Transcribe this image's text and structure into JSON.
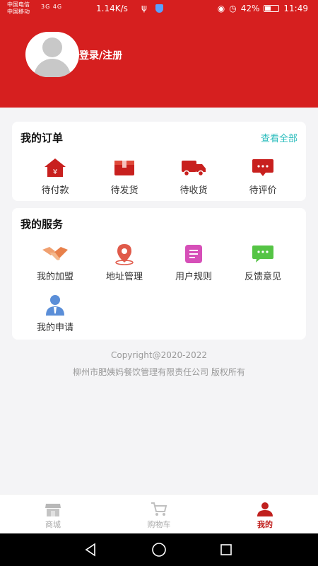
{
  "status_bar": {
    "carrier_1": "中国电信",
    "carrier_2": "中国移动",
    "signal": "3G 4G",
    "speed": "1.14K/s",
    "battery": "42%",
    "time": "11:49"
  },
  "header": {
    "login_label": "登录/注册"
  },
  "orders": {
    "title": "我的订单",
    "view_all": "查看全部",
    "items": [
      {
        "label": "待付款",
        "icon": "house-yen-icon"
      },
      {
        "label": "待发货",
        "icon": "package-icon"
      },
      {
        "label": "待收货",
        "icon": "truck-icon"
      },
      {
        "label": "待评价",
        "icon": "comment-icon"
      }
    ]
  },
  "services": {
    "title": "我的服务",
    "items": [
      {
        "label": "我的加盟",
        "icon": "handshake-icon"
      },
      {
        "label": "地址管理",
        "icon": "location-pin-icon"
      },
      {
        "label": "用户规则",
        "icon": "document-icon"
      },
      {
        "label": "反馈意见",
        "icon": "chat-bubble-icon"
      },
      {
        "label": "我的申请",
        "icon": "user-icon"
      }
    ]
  },
  "footer": {
    "copyright": "Copyright@2020-2022",
    "company": "柳州市肥姨妈餐饮管理有限责任公司 版权所有"
  },
  "tabbar": {
    "items": [
      {
        "label": "商城",
        "icon": "store-icon",
        "active": false
      },
      {
        "label": "购物车",
        "icon": "cart-icon",
        "active": false
      },
      {
        "label": "我的",
        "icon": "profile-icon",
        "active": true
      }
    ]
  },
  "colors": {
    "primary_red": "#d61f1f",
    "accent_teal": "#2bbdbd",
    "active_tab": "#c0201e"
  }
}
